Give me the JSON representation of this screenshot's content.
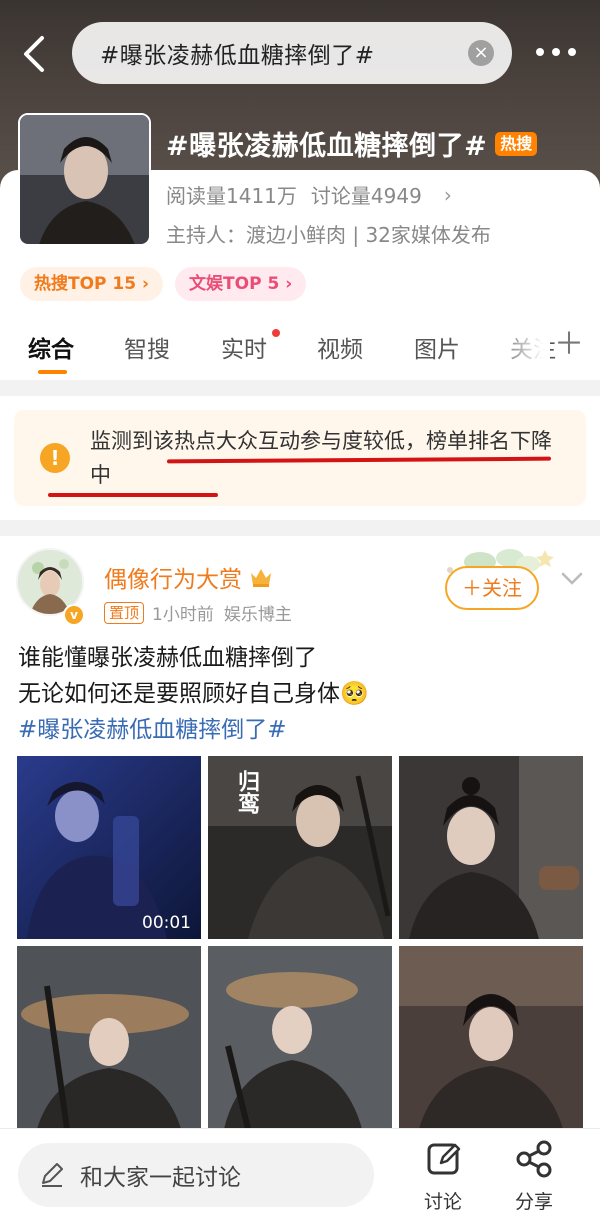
{
  "header": {
    "search_text": "#曝张凌赫低血糖摔倒了#"
  },
  "topic": {
    "title": "#曝张凌赫低血糖摔倒了#",
    "hot_badge": "热搜",
    "reads": "阅读量1411万",
    "discussions": "讨论量4949",
    "host": "主持人：渡边小鲜肉 | 32家媒体发布",
    "pills": [
      "热搜TOP 15 ›",
      "文娱TOP 5 ›"
    ]
  },
  "tabs": [
    "综合",
    "智搜",
    "实时",
    "视频",
    "图片",
    "关注"
  ],
  "notice": {
    "text": "监测到该热点大众互动参与度较低，榜单排名下降中"
  },
  "post": {
    "username": "偶像行为大赏",
    "pinned": "置顶",
    "time": "1小时前",
    "category": "娱乐博主",
    "follow": "＋关注",
    "line1": "谁能懂曝张凌赫低血糖摔倒了",
    "line2": "无论如何还是要照顾好自己身体🥺",
    "hashtag": "#曝张凌赫低血糖摔倒了#",
    "video_duration": "00:01",
    "image_caption": "归鸾"
  },
  "bottom": {
    "input_placeholder": "和大家一起讨论",
    "discuss": "讨论",
    "share": "分享"
  },
  "colors": {
    "accent": "#ff8200",
    "hashtag": "#3a6bb5",
    "underline": "#d41414"
  }
}
